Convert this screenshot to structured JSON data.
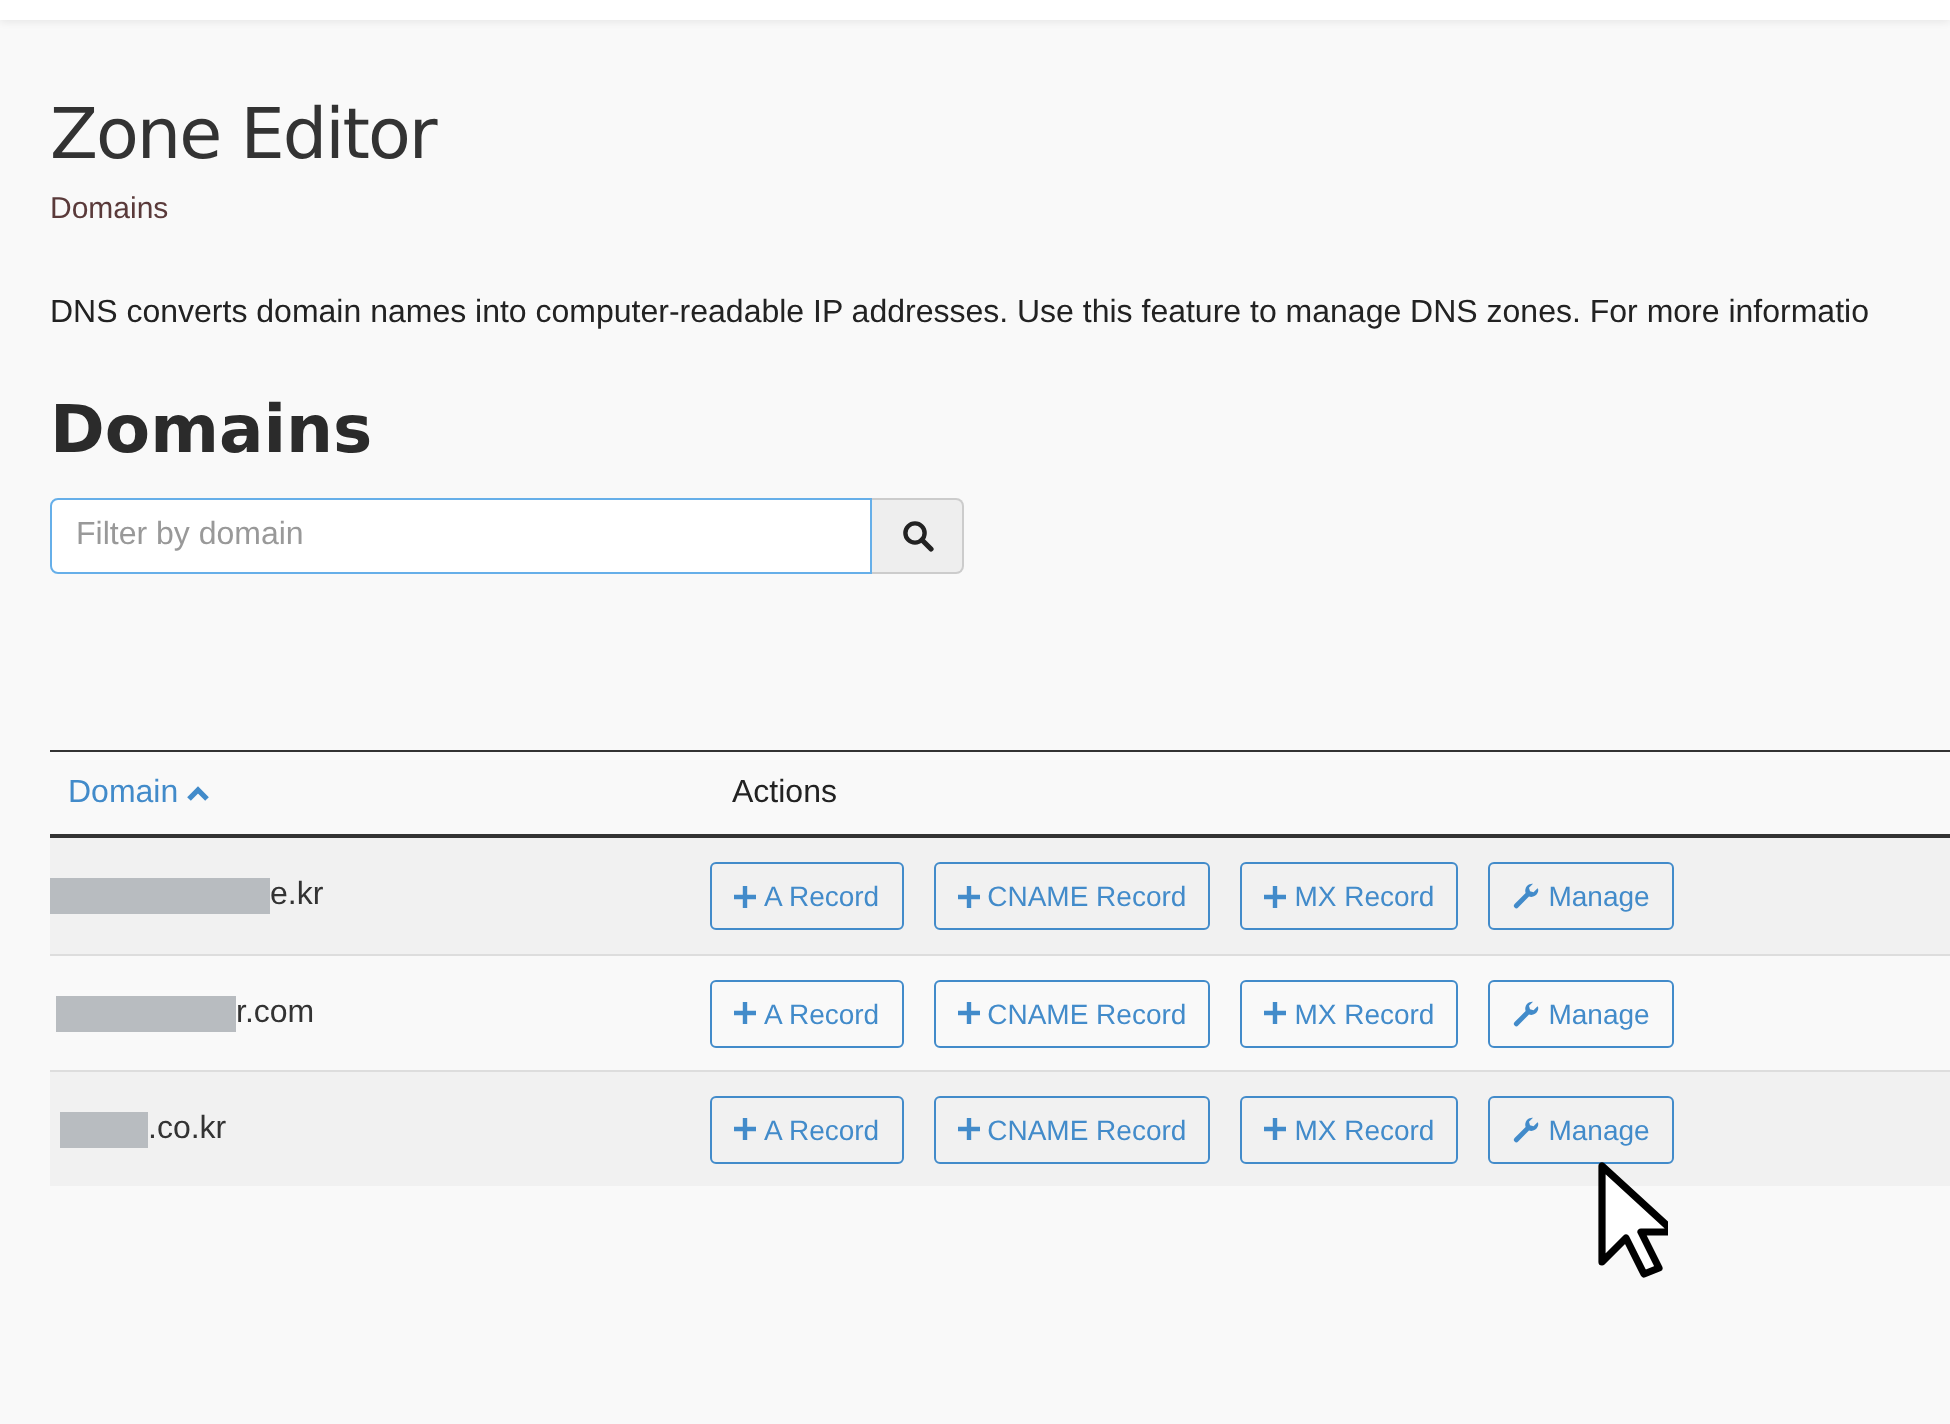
{
  "page": {
    "title": "Zone Editor",
    "breadcrumb": "Domains",
    "description": "DNS converts domain names into computer-readable IP addresses. Use this feature to manage DNS zones. For more informatio"
  },
  "section": {
    "title": "Domains"
  },
  "search": {
    "placeholder": "Filter by domain"
  },
  "table": {
    "columns": [
      {
        "label": "Domain",
        "sorted": true
      },
      {
        "label": "Actions",
        "sorted": false
      }
    ],
    "rows": [
      {
        "domain": "e.kr",
        "actions": [
          {
            "kind": "add",
            "label": "A Record"
          },
          {
            "kind": "add",
            "label": "CNAME Record"
          },
          {
            "kind": "add",
            "label": "MX Record"
          },
          {
            "kind": "manage",
            "label": "Manage"
          }
        ]
      },
      {
        "domain": "r.com",
        "actions": [
          {
            "kind": "add",
            "label": "A Record"
          },
          {
            "kind": "add",
            "label": "CNAME Record"
          },
          {
            "kind": "add",
            "label": "MX Record"
          },
          {
            "kind": "manage",
            "label": "Manage"
          }
        ]
      },
      {
        "domain": ".co.kr",
        "actions": [
          {
            "kind": "add",
            "label": "A Record"
          },
          {
            "kind": "add",
            "label": "CNAME Record"
          },
          {
            "kind": "add",
            "label": "MX Record"
          },
          {
            "kind": "manage",
            "label": "Manage"
          }
        ]
      }
    ]
  }
}
